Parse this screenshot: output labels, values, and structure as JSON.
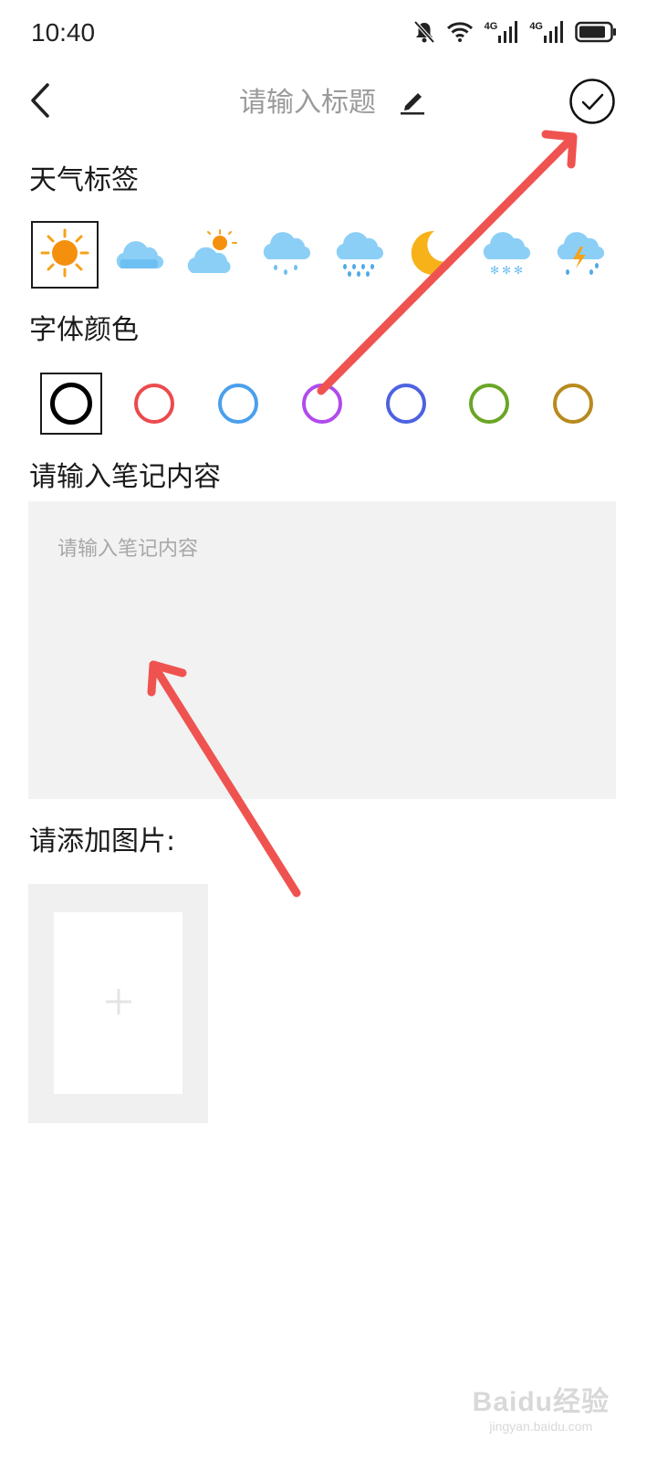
{
  "status_bar": {
    "time": "10:40",
    "network_1": "4G",
    "network_2": "4G",
    "icons": [
      "bell-off-icon",
      "wifi-icon",
      "signal-icon",
      "signal-icon",
      "battery-icon"
    ]
  },
  "header": {
    "title_placeholder": "请输入标题",
    "back_icon": "chevron-left-icon",
    "edit_icon": "pencil-icon",
    "confirm_icon": "check-circle-icon"
  },
  "weather": {
    "label": "天气标签",
    "selected_index": 0,
    "options": [
      "sunny-icon",
      "cloudy-icon",
      "partly-cloudy-icon",
      "light-rain-icon",
      "rain-icon",
      "moon-icon",
      "snow-icon",
      "thunderstorm-icon"
    ]
  },
  "font_color": {
    "label": "字体颜色",
    "selected_index": 0,
    "colors": [
      "#000000",
      "#ec4a4d",
      "#4aa0ec",
      "#b04bec",
      "#4d62e0",
      "#6aa626",
      "#b88a1e"
    ]
  },
  "content": {
    "label": "请输入笔记内容",
    "placeholder": "请输入笔记内容",
    "value": ""
  },
  "image": {
    "label": "请添加图片:",
    "add_icon": "plus-icon"
  },
  "annotation_color": "#ef5350",
  "watermark": {
    "brand": "Baidu经验",
    "url": "jingyan.baidu.com"
  }
}
